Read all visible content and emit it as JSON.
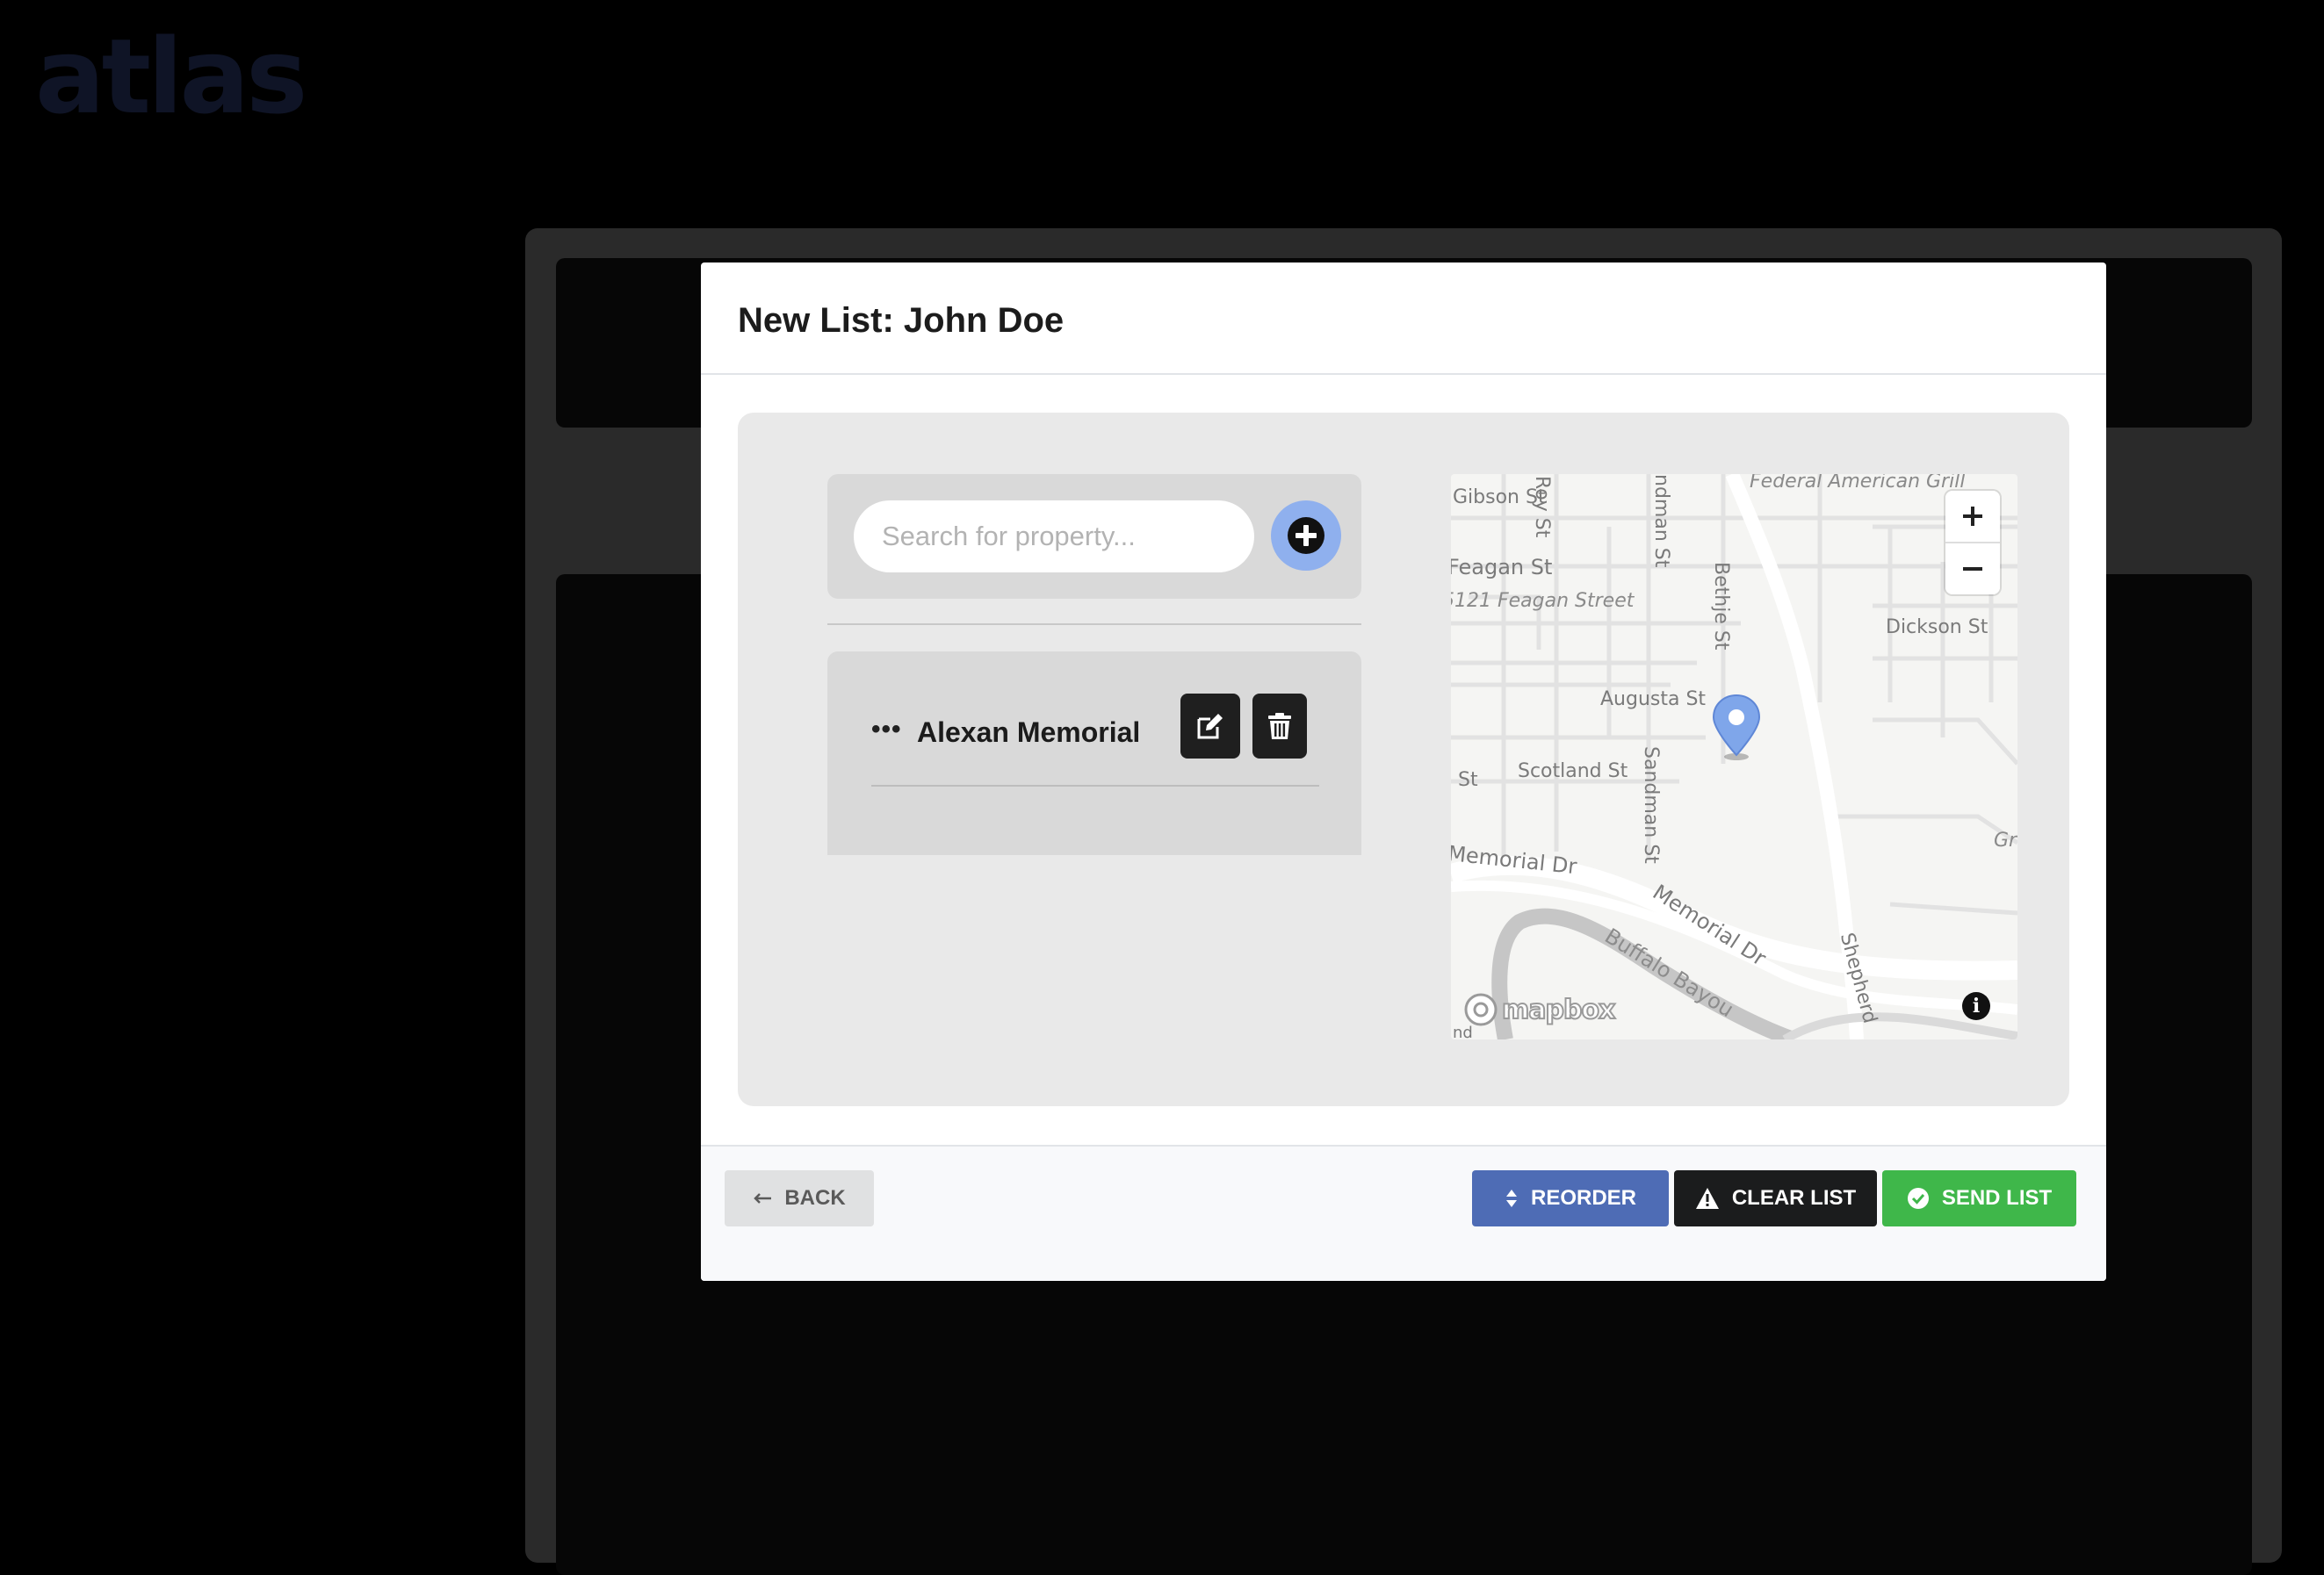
{
  "app": {
    "logo": "atlas"
  },
  "modal": {
    "title": "New List: John Doe",
    "search": {
      "placeholder": "Search for property..."
    },
    "list_items": [
      {
        "label": "Alexan Memorial"
      }
    ],
    "map": {
      "labels": {
        "gibson": "Gibson St",
        "roy": "Roy St",
        "sandman_top": "ndman St",
        "federal": "Federal American Grill",
        "feagan": "Feagan St",
        "feagan_street": "5121 Feagan Street",
        "bethje": "Bethje St",
        "dickson": "Dickson St",
        "augusta": "Augusta St",
        "st_left": "St",
        "scotland": "Scotland St",
        "sandman": "Sandman St",
        "memorial_left": "Memorial Dr",
        "memorial": "Memorial Dr",
        "buffalo": "Buffalo Bayou",
        "shepherd": "Shepherd",
        "gra": "Gra",
        "nd": "nd"
      },
      "attribution": "mapbox"
    },
    "footer": {
      "back": "BACK",
      "reorder": "REORDER",
      "clear": "CLEAR LIST",
      "send": "SEND LIST"
    }
  },
  "colors": {
    "reorder": "#4e6cb5",
    "clear": "#1b1c1d",
    "send": "#3fb74a",
    "add_button": "#8fb0ee",
    "pin": "#7fa6ea"
  }
}
